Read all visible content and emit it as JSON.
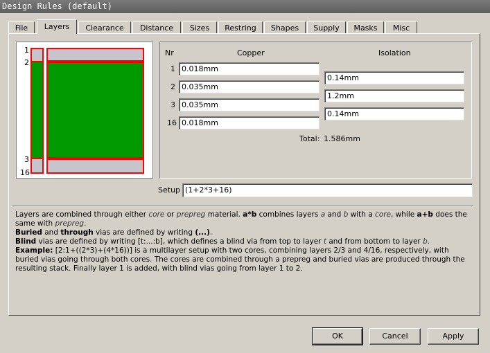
{
  "window": {
    "title": "Design Rules (default)"
  },
  "tabs": [
    "File",
    "Layers",
    "Clearance",
    "Distance",
    "Sizes",
    "Restring",
    "Shapes",
    "Supply",
    "Masks",
    "Misc"
  ],
  "stack_labels": [
    "1",
    "2",
    "3",
    "16"
  ],
  "colors": {
    "copper": "#ff0000",
    "core": "#009900",
    "prepreg": "#c8c4cc"
  },
  "layers": {
    "headers": {
      "nr": "Nr",
      "copper": "Copper",
      "isolation": "Isolation"
    },
    "rows": [
      {
        "nr": "1",
        "copper": "0.018mm"
      },
      {
        "nr": "2",
        "copper": "0.035mm"
      },
      {
        "nr": "3",
        "copper": "0.035mm"
      },
      {
        "nr": "16",
        "copper": "0.018mm"
      }
    ],
    "isolation": [
      "0.14mm",
      "1.2mm",
      "0.14mm"
    ],
    "total_label": "Total:",
    "total_value": "1.586mm"
  },
  "setup": {
    "label": "Setup",
    "value": "(1+2*3+16)"
  },
  "help": {
    "l1_a": "Layers are combined through either ",
    "l1_core": "core",
    "l1_b": " or ",
    "l1_prepreg": "prepreg",
    "l1_c": " material. ",
    "l1_axb": "a*b",
    "l1_d": " combines layers ",
    "l1_a_it": "a",
    "l1_e": " and ",
    "l1_b_it": "b",
    "l1_f": " with a ",
    "l1_core2": "core",
    "l1_g": ", while ",
    "l1_apb": "a+b",
    "l1_h": " does the same with ",
    "l1_prepreg2": "prepreg",
    "l1_i": ".",
    "l2_buried": "Buried",
    "l2_a": " and ",
    "l2_through": "through",
    "l2_b": " vias are defined by writing ",
    "l2_paren": "(...)",
    "l2_c": ".",
    "l3_blind": "Blind",
    "l3_a": " vias are defined by writing [t:...:b], which defines a blind via from top to layer ",
    "l3_t": "t",
    "l3_b": " and from bottom to layer ",
    "l3_bb": "b",
    "l3_c": ".",
    "l4_example": "Example:",
    "l4_text": " [2:1+((2*3)+(4*16))] is a multilayer setup with two cores, combining layers 2/3 and 4/16, respectively, with buried vias going through both cores. The cores are combined through a prepreg and buried vias are produced through the resulting stack. Finally layer 1 is added, with blind vias going from layer 1 to 2."
  },
  "buttons": {
    "ok": "OK",
    "cancel": "Cancel",
    "apply": "Apply"
  }
}
